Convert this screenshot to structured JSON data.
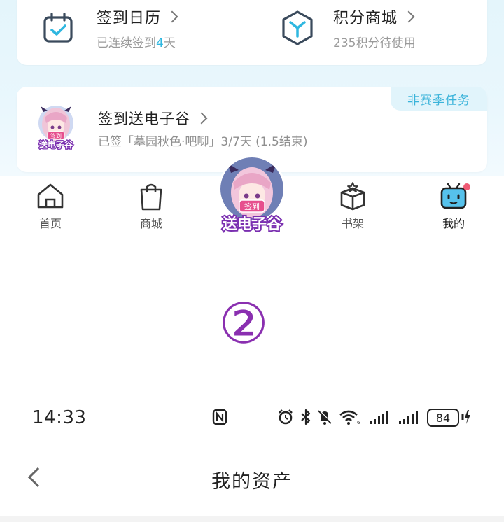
{
  "topCard": {
    "calendar": {
      "title": "签到日历",
      "sub_prefix": "已连续签到",
      "days": "4",
      "sub_suffix": "天",
      "icon": "calendar-check-icon"
    },
    "points": {
      "title": "积分商城",
      "sub": "235积分待使用",
      "icon": "cube-icon"
    }
  },
  "task": {
    "badge": "非赛季任务",
    "title": "签到送电子谷",
    "sub": "已签「墓园秋色·吧唧」3/7天 (1.5结束)",
    "avatar_tag": "签到",
    "avatar_label": "送电子谷"
  },
  "tabs": {
    "home": "首页",
    "store": "商城",
    "shelf": "书架",
    "mine": "我的",
    "center_tag": "签到",
    "center_label": "送电子谷"
  },
  "annotation": "②",
  "status": {
    "time": "14:33",
    "battery": "84"
  },
  "header": {
    "title": "我的资产"
  },
  "colors": {
    "accent": "#2fb7e0",
    "badge_bg": "#e1f4fb",
    "annotation": "#8a2fb0",
    "notify_dot": "#ef5a73"
  }
}
